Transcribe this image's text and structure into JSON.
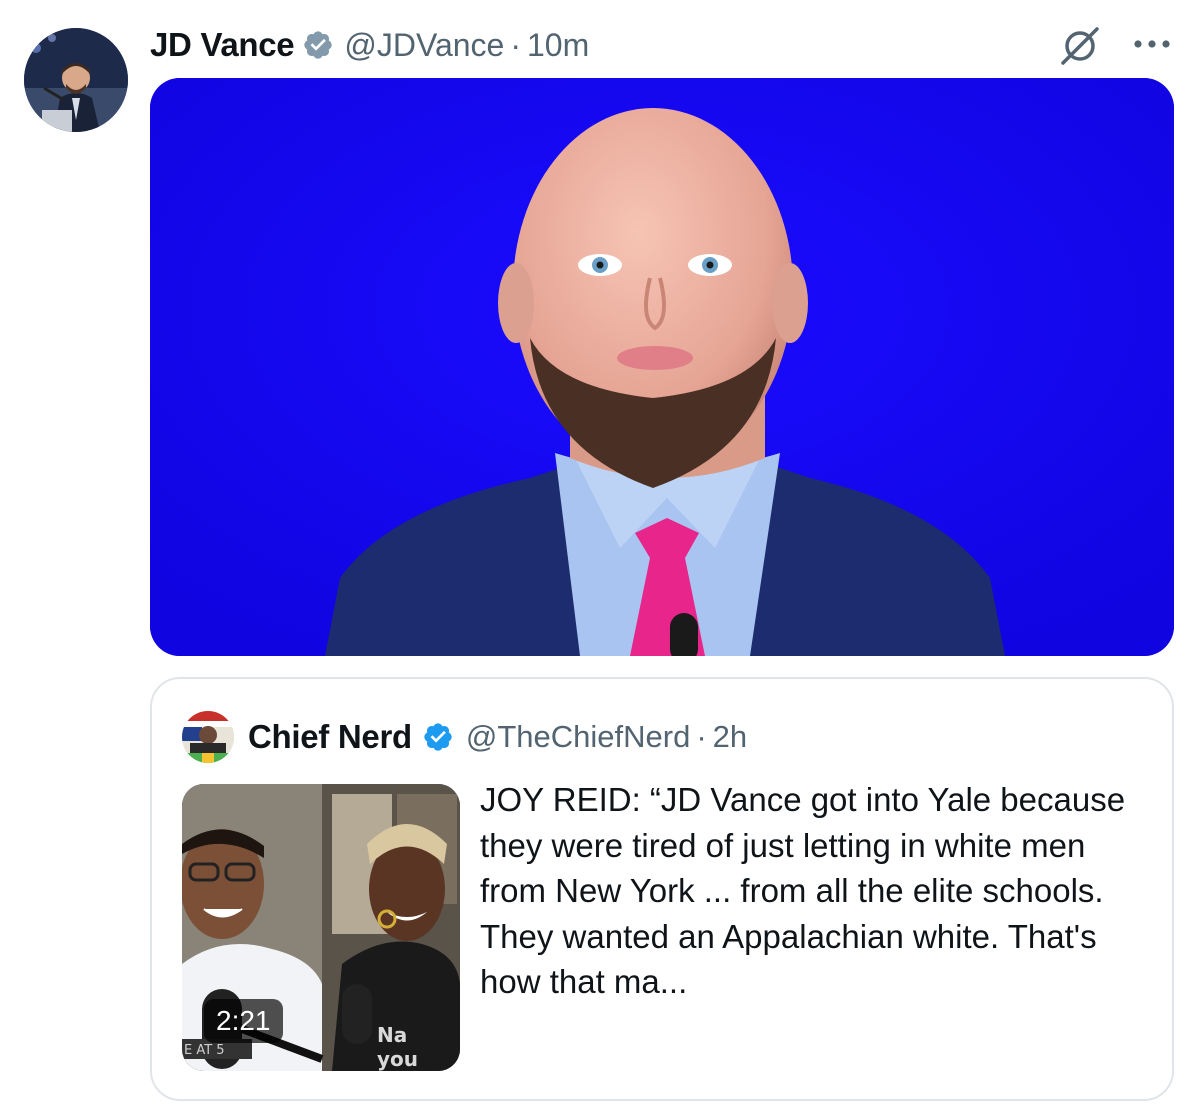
{
  "post": {
    "display_name": "JD Vance",
    "handle": "@JDVance",
    "separator": "·",
    "timestamp": "10m",
    "avatar_icon": "profile-photo-speaker-at-podium",
    "verified_icon": "verified-badge-icon",
    "verified_color": "#829aab",
    "grok_icon": "grok-icon",
    "more_icon": "more-icon",
    "media": {
      "type": "photo",
      "background_color": "#1404f2",
      "description_icon": "man-in-suit-pink-tie-blue-background"
    }
  },
  "quoted_post": {
    "display_name": "Chief Nerd",
    "handle": "@TheChiefNerd",
    "separator": "·",
    "timestamp": "2h",
    "verified_icon": "verified-badge-icon",
    "verified_color": "#1d9bf0",
    "avatar_icon": "chief-nerd-avatar",
    "video": {
      "duration": "2:21",
      "thumbnail_icon": "video-thumbnail-two-hosts"
    },
    "text": "JOY REID: “JD Vance got into Yale because they were tired of just letting in white men from New York ... from all the elite schools. They wanted an Appalachian white. That's how that ma..."
  },
  "colors": {
    "text_primary": "#0f1419",
    "text_secondary": "#536471",
    "border": "#e1e5e9"
  }
}
